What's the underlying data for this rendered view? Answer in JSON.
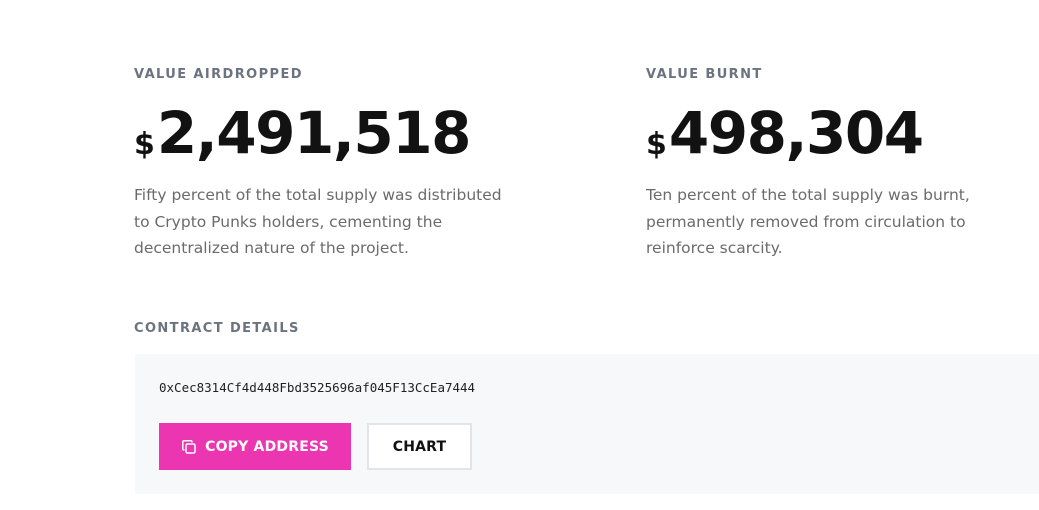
{
  "stats": {
    "airdropped": {
      "label": "VALUE AIRDROPPED",
      "currency": "$",
      "value": "2,491,518",
      "description": "Fifty percent of the total supply was distributed to Crypto Punks holders, cementing the decentralized nature of the project."
    },
    "burnt": {
      "label": "VALUE BURNT",
      "currency": "$",
      "value": "498,304",
      "description": "Ten percent of the total supply was burnt, permanently removed from circulation to reinforce scarcity."
    }
  },
  "contract": {
    "label": "CONTRACT DETAILS",
    "address": "0xCec8314Cf4d448Fbd3525696af045F13CcEa7444",
    "copy_button_label": "COPY ADDRESS",
    "copy_icon": "copy-icon",
    "chart_button_label": "CHART"
  },
  "colors": {
    "accent": "#ec35b0",
    "label": "#6b7280",
    "panel": "#f7f8fa"
  }
}
